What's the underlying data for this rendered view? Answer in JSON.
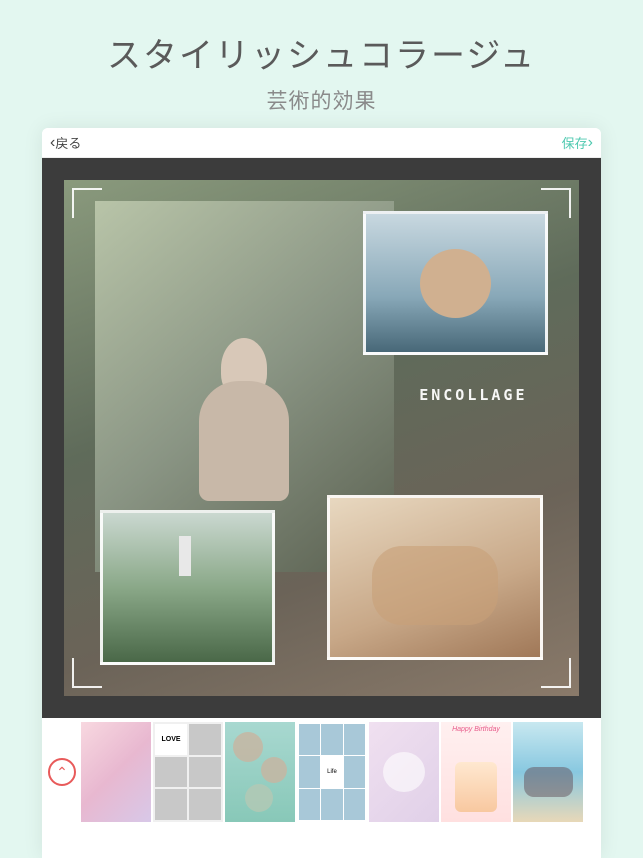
{
  "hero": {
    "title": "スタイリッシュコラージュ",
    "subtitle": "芸術的効果"
  },
  "topbar": {
    "back": "戻る",
    "save": "保存"
  },
  "collage": {
    "watermark": "ENCOLLAGE"
  },
  "templates": {
    "love_label": "LOVE",
    "life_label": "Life",
    "birthday_label": "Happy Birthday"
  }
}
